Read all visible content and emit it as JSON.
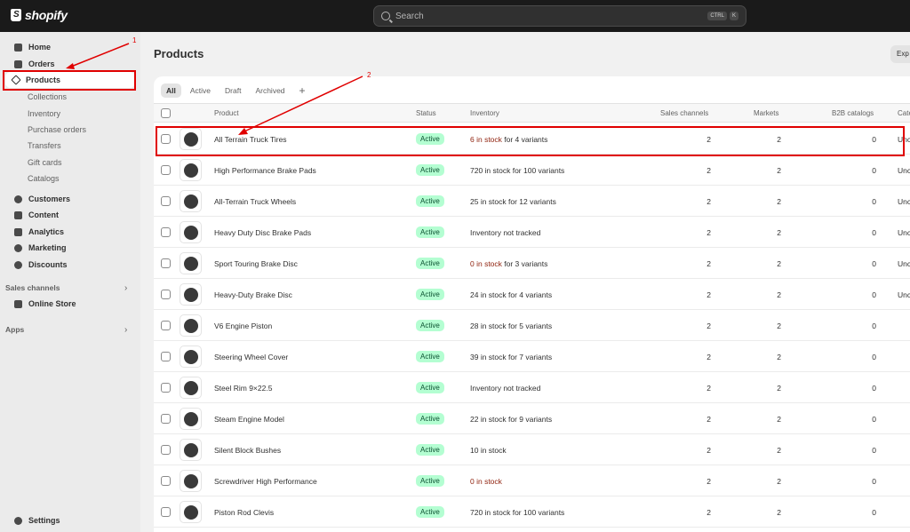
{
  "topbar": {
    "logo_text": "shopify",
    "search_placeholder": "Search",
    "kbd1": "CTRL",
    "kbd2": "K"
  },
  "sidebar": {
    "home": "Home",
    "orders": "Orders",
    "products": "Products",
    "sub": [
      "Collections",
      "Inventory",
      "Purchase orders",
      "Transfers",
      "Gift cards",
      "Catalogs"
    ],
    "customers": "Customers",
    "content": "Content",
    "analytics": "Analytics",
    "marketing": "Marketing",
    "discounts": "Discounts",
    "sales_channels": "Sales channels",
    "online_store": "Online Store",
    "apps": "Apps",
    "settings": "Settings"
  },
  "page": {
    "title": "Products",
    "export": "Exp"
  },
  "tabs": [
    "All",
    "Active",
    "Draft",
    "Archived"
  ],
  "columns": {
    "product": "Product",
    "status": "Status",
    "inventory": "Inventory",
    "sales_channels": "Sales channels",
    "markets": "Markets",
    "b2b": "B2B catalogs",
    "category": "Cate"
  },
  "rows": [
    {
      "name": "All Terrain Truck Tires",
      "status": "Active",
      "inv_low": "6 in stock",
      "inv_rest": " for 4 variants",
      "sales": "2",
      "markets": "2",
      "b2b": "0",
      "cat": "Unc"
    },
    {
      "name": "High Performance Brake Pads",
      "status": "Active",
      "inv_low": "",
      "inv_rest": "720 in stock for 100 variants",
      "sales": "2",
      "markets": "2",
      "b2b": "0",
      "cat": "Unc"
    },
    {
      "name": "All-Terrain Truck Wheels",
      "status": "Active",
      "inv_low": "",
      "inv_rest": "25 in stock for 12 variants",
      "sales": "2",
      "markets": "2",
      "b2b": "0",
      "cat": "Unc"
    },
    {
      "name": "Heavy Duty Disc Brake Pads",
      "status": "Active",
      "inv_low": "",
      "inv_rest": "Inventory not tracked",
      "sales": "2",
      "markets": "2",
      "b2b": "0",
      "cat": "Unc"
    },
    {
      "name": "Sport Touring Brake Disc",
      "status": "Active",
      "inv_low": "0 in stock",
      "inv_rest": " for 3 variants",
      "sales": "2",
      "markets": "2",
      "b2b": "0",
      "cat": "Unc"
    },
    {
      "name": "Heavy-Duty Brake Disc",
      "status": "Active",
      "inv_low": "",
      "inv_rest": "24 in stock for 4 variants",
      "sales": "2",
      "markets": "2",
      "b2b": "0",
      "cat": "Unc"
    },
    {
      "name": "V6 Engine Piston",
      "status": "Active",
      "inv_low": "",
      "inv_rest": "28 in stock for 5 variants",
      "sales": "2",
      "markets": "2",
      "b2b": "0",
      "cat": ""
    },
    {
      "name": "Steering Wheel Cover",
      "status": "Active",
      "inv_low": "",
      "inv_rest": "39 in stock for 7 variants",
      "sales": "2",
      "markets": "2",
      "b2b": "0",
      "cat": ""
    },
    {
      "name": "Steel Rim 9×22.5",
      "status": "Active",
      "inv_low": "",
      "inv_rest": "Inventory not tracked",
      "sales": "2",
      "markets": "2",
      "b2b": "0",
      "cat": ""
    },
    {
      "name": "Steam Engine Model",
      "status": "Active",
      "inv_low": "",
      "inv_rest": "22 in stock for 9 variants",
      "sales": "2",
      "markets": "2",
      "b2b": "0",
      "cat": ""
    },
    {
      "name": "Silent Block Bushes",
      "status": "Active",
      "inv_low": "",
      "inv_rest": "10 in stock",
      "sales": "2",
      "markets": "2",
      "b2b": "0",
      "cat": ""
    },
    {
      "name": "Screwdriver High Performance",
      "status": "Active",
      "inv_low": "0 in stock",
      "inv_rest": "",
      "sales": "2",
      "markets": "2",
      "b2b": "0",
      "cat": ""
    },
    {
      "name": "Piston Rod Clevis",
      "status": "Active",
      "inv_low": "",
      "inv_rest": "720 in stock for 100 variants",
      "sales": "2",
      "markets": "2",
      "b2b": "0",
      "cat": ""
    }
  ],
  "annotations": {
    "a1": "1",
    "a2": "2"
  }
}
